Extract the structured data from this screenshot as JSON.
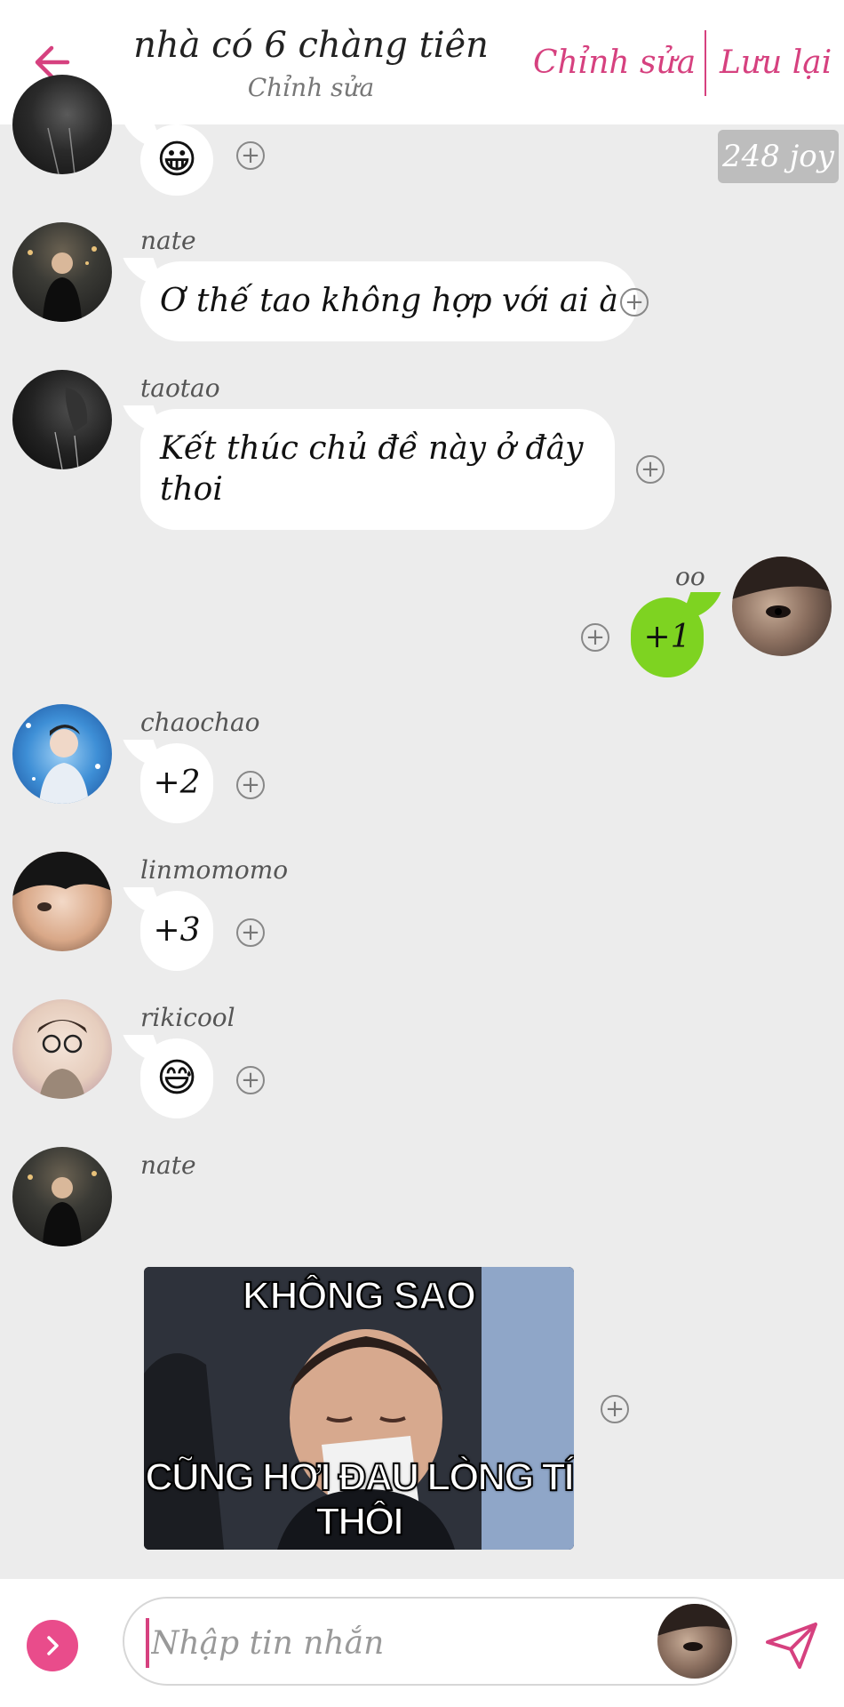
{
  "header": {
    "title": "nhà có 6 chàng tiên",
    "subtitle": "Chỉnh sửa",
    "edit_label": "Chỉnh sửa",
    "save_label": "Lưu lại",
    "accent_color": "#d6417f"
  },
  "joy_badge": "248 joy",
  "messages": [
    {
      "sender": "",
      "text": "😀",
      "type": "emoji"
    },
    {
      "sender": "nate",
      "text": "Ơ thế tao không hợp với ai à"
    },
    {
      "sender": "taotao",
      "text_line1": "Kết thúc chủ đề này ở đây",
      "text_line2": "thoi"
    },
    {
      "sender": "oo",
      "text": "+1",
      "own": true
    },
    {
      "sender": "chaochao",
      "text": "+2"
    },
    {
      "sender": "linmomomo",
      "text": "+3"
    },
    {
      "sender": "rikicool",
      "text": "😅",
      "type": "emoji"
    },
    {
      "sender": "nate",
      "type": "image",
      "meme_top": "KHÔNG SAO",
      "meme_bottom": "CŨNG HƠI ĐAU LÒNG TÍ THÔI"
    }
  ],
  "composer": {
    "placeholder": "Nhập tin nhắn"
  },
  "icons": {
    "back": "back-arrow-icon",
    "add_reaction": "plus-circle-icon",
    "expand": "chevron-right-icon",
    "send": "send-icon"
  }
}
